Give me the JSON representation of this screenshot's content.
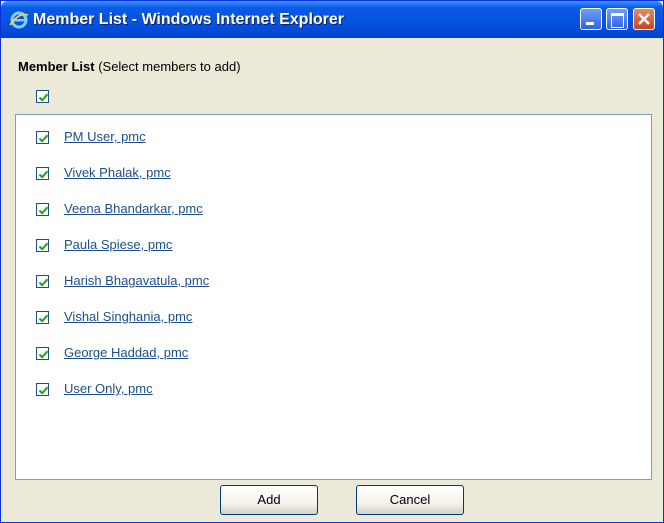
{
  "window": {
    "title": "Member List - Windows Internet Explorer",
    "controls": {
      "minimize": "minimize-icon",
      "maximize": "maximize-icon",
      "close": "close-icon"
    }
  },
  "dialog": {
    "heading_bold": "Member List",
    "heading_note": " (Select members to add)",
    "select_all_checked": true
  },
  "members": [
    {
      "name": "PM User, pmc",
      "checked": true
    },
    {
      "name": "Vivek Phalak, pmc",
      "checked": true
    },
    {
      "name": "Veena Bhandarkar, pmc",
      "checked": true
    },
    {
      "name": "Paula Spiese, pmc",
      "checked": true
    },
    {
      "name": "Harish Bhagavatula, pmc",
      "checked": true
    },
    {
      "name": "Vishal Singhania, pmc",
      "checked": true
    },
    {
      "name": "George Haddad, pmc",
      "checked": true
    },
    {
      "name": "User Only, pmc",
      "checked": true
    }
  ],
  "buttons": {
    "add_label": "Add",
    "cancel_label": "Cancel"
  },
  "colors": {
    "titlebar": "#0553E0",
    "link": "#1E4F8C",
    "checkmark": "#21A121",
    "panel_border": "#7F9DB9"
  }
}
